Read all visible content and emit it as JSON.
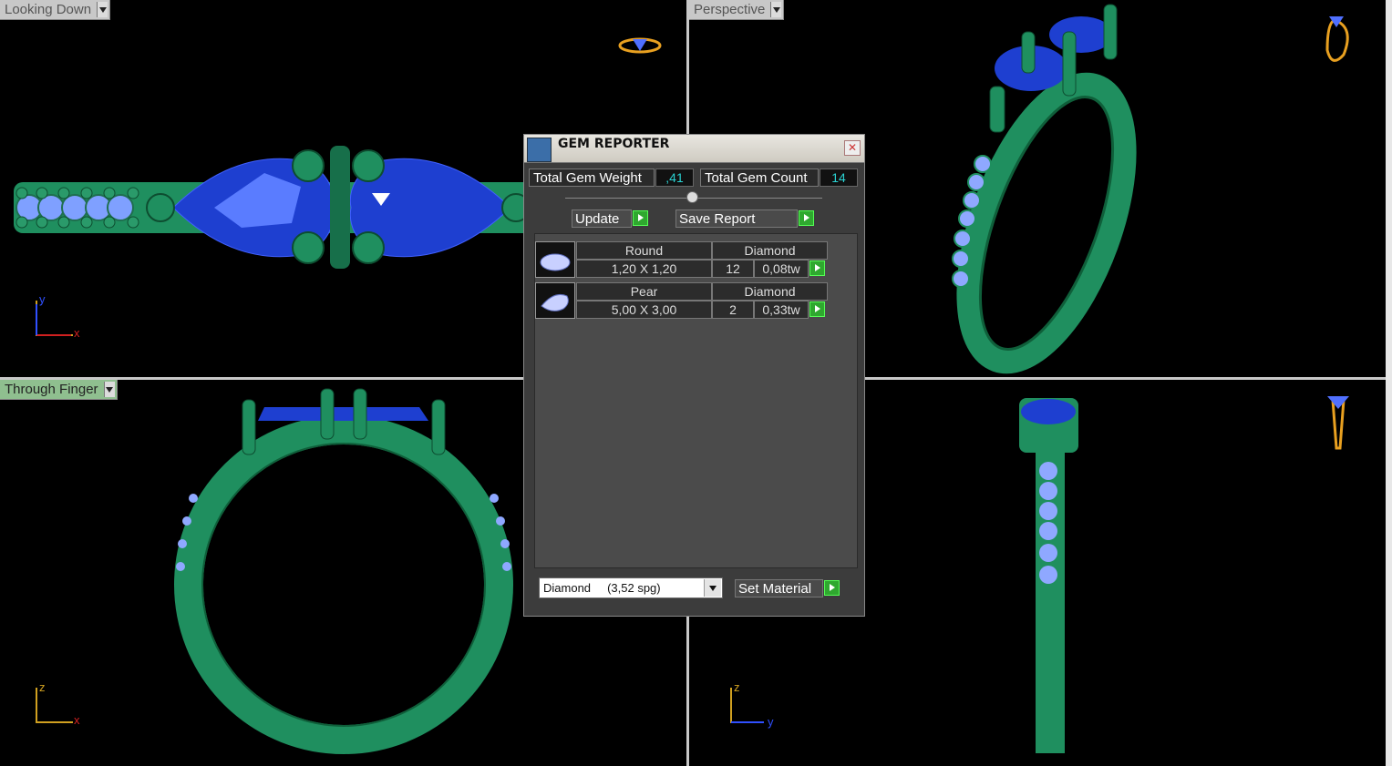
{
  "viewports": {
    "top_left": {
      "label": "Looking Down",
      "axis_v": "y",
      "axis_h": "x"
    },
    "top_right": {
      "label": "Perspective"
    },
    "bottom_left": {
      "label": "Through Finger",
      "axis_v": "z",
      "axis_h": "x"
    },
    "bottom_right": {
      "axis_v": "z",
      "axis_h": "y"
    }
  },
  "colors": {
    "metal": "#1f8f5f",
    "gem_blue": "#1e3fd0",
    "diamond": "#8fa8ff",
    "axis_red": "#d02020",
    "axis_yellow": "#d0a020",
    "axis_blue": "#3050ff",
    "label_active": "#8fbf8f"
  },
  "gem_reporter": {
    "title": "GEM REPORTER",
    "close_icon": "close-icon",
    "total_weight_label": "Total Gem Weight",
    "total_weight_value": ",41",
    "total_count_label": "Total Gem Count",
    "total_count_value": "14",
    "update_label": "Update",
    "save_report_label": "Save Report",
    "gems": [
      {
        "shape": "Round",
        "material": "Diamond",
        "size": "1,20 X 1,20",
        "count": "12",
        "weight": "0,08tw"
      },
      {
        "shape": "Pear",
        "material": "Diamond",
        "size": "5,00 X 3,00",
        "count": "2",
        "weight": "0,33tw"
      }
    ],
    "material_select": "Diamond     (3,52 spg)",
    "set_material_label": "Set Material"
  }
}
